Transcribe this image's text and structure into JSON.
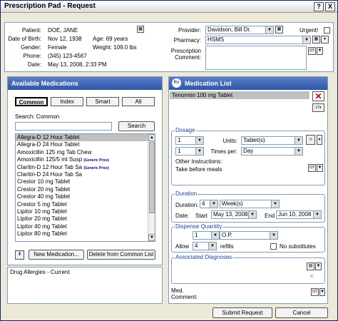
{
  "window": {
    "title": "Prescription Pad - Request",
    "help_label": "?",
    "close_label": "X"
  },
  "patient": {
    "patient_label": "Patient:",
    "patient": "DOE, JANE",
    "dob_label": "Date of Birth:",
    "dob": "Nov 12, 1938",
    "age": "Age: 69 years",
    "gender_label": "Gender:",
    "gender": "Female",
    "weight": "Weight: 109.0 lbs",
    "phone_label": "Phone:",
    "phone": "(345) 123-4567",
    "date_label": "Date:",
    "date": "May 13, 2008, 2:33 PM"
  },
  "provider": {
    "provider_label": "Provider:",
    "provider": "Davidson, Bill Dr.",
    "urgent_label": "Urgent!",
    "pharmacy_label": "Pharmacy:",
    "pharmacy": "HSMS",
    "comment_label_1": "Prescription",
    "comment_label_2": "Comment:"
  },
  "available": {
    "title": "Available Medications",
    "tabs": [
      "Common",
      "Index",
      "Smart",
      "All"
    ],
    "search_label": "Search: Common",
    "search_value": "",
    "search_button": "Search",
    "generic_price": "(Generic Price)",
    "items": [
      {
        "name": "Allegra-D 12 Hour Tablet",
        "selected": true,
        "gp": false
      },
      {
        "name": "Allegra-D 24 Hour Tablet",
        "selected": false,
        "gp": false
      },
      {
        "name": "Amoxicillin 125 mg Tab Chew",
        "selected": false,
        "gp": false
      },
      {
        "name": "Amoxicillin 125/5 ml Susp",
        "selected": false,
        "gp": true
      },
      {
        "name": "Claritin-D 12 Hour Tab Sa",
        "selected": false,
        "gp": true
      },
      {
        "name": "Claritin-D 24 Hour Tab Sa",
        "selected": false,
        "gp": false
      },
      {
        "name": "Crestor 10 mg Tablet",
        "selected": false,
        "gp": false
      },
      {
        "name": "Crestor 20 mg Tablet",
        "selected": false,
        "gp": false
      },
      {
        "name": "Crestor 40 mg Tablet",
        "selected": false,
        "gp": false
      },
      {
        "name": "Crestor 5 mg Tablet",
        "selected": false,
        "gp": false
      },
      {
        "name": "Lipitor 10 mg Tablet",
        "selected": false,
        "gp": false
      },
      {
        "name": "Lipitor 20 mg Tablet",
        "selected": false,
        "gp": false
      },
      {
        "name": "Lipitor 40 mg Tablet",
        "selected": false,
        "gp": false
      },
      {
        "name": "Lipitor 80 mg Tablet",
        "selected": false,
        "gp": false
      }
    ],
    "new_med_button": "New Medication...",
    "delete_button": "Delete from Common List",
    "allergies_label": "Drug Allergies - Current"
  },
  "medlist": {
    "title": "Medication List",
    "logo": "Rx",
    "selected_med": "Tenormin 100 mg Tablet",
    "lt_label": "LT",
    "dosage": {
      "legend": "Dosage",
      "amount": "1",
      "units_label": "Units:",
      "units": "Tablet(s)",
      "freq": "1",
      "times_label": "Times per:",
      "per": "Day",
      "other_label": "Other Instructions:",
      "instructions": "Take before meals"
    },
    "duration": {
      "legend": "Duration",
      "duration_label": "Duration:",
      "num": "4",
      "unit": "Week(s)",
      "date_label": "Date:",
      "start_label": "Start",
      "start": "May 13, 2008",
      "end_label": "End",
      "end": "Jun 10, 2008"
    },
    "dispense": {
      "legend": "Dispense Quantity",
      "qty": "1",
      "form": "O.P.",
      "allow_label": "Allow",
      "refills": "4",
      "refills_label": "refills",
      "no_sub_label": "No substitutes"
    },
    "diagnoses": {
      "legend": "Associated Diagnoses"
    },
    "med_comment_1": "Med.",
    "med_comment_2": "Comment:"
  },
  "footer": {
    "submit": "Submit Request",
    "cancel": "Cancel"
  },
  "colors": {
    "header": "#2d56a8",
    "accent_red": "#c00000",
    "legend": "#1f3f9a"
  }
}
